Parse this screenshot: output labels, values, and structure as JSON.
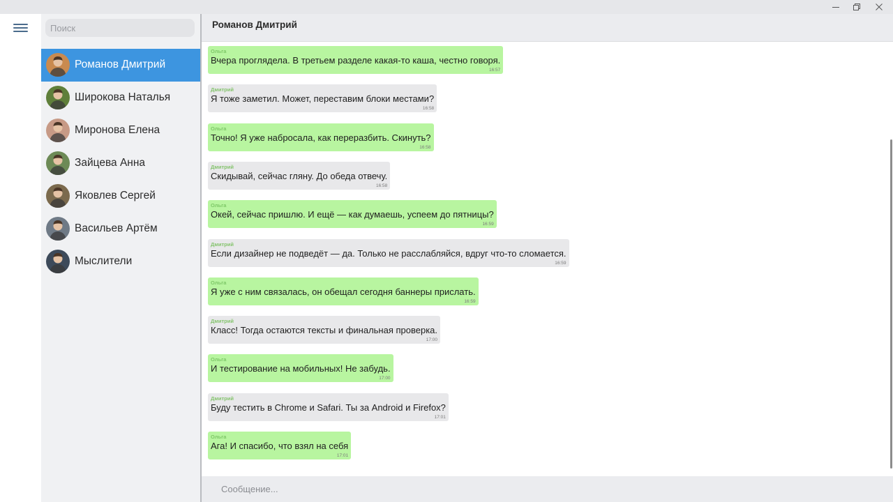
{
  "window": {
    "min_icon": "minimize-icon",
    "max_icon": "restore-icon",
    "close_icon": "close-icon"
  },
  "rail": {
    "menu_icon": "hamburger-menu-icon"
  },
  "sidebar": {
    "search_placeholder": "Поиск",
    "chats": [
      {
        "name": "Романов Дмитрий",
        "avatar_color": "#c98a4f",
        "active": true
      },
      {
        "name": "Широкова Наталья",
        "avatar_color": "#5f7f3a",
        "active": false
      },
      {
        "name": "Миронова Елена",
        "avatar_color": "#c79a86",
        "active": false
      },
      {
        "name": "Зайцева Анна",
        "avatar_color": "#6d8a56",
        "active": false
      },
      {
        "name": "Яковлев Сергей",
        "avatar_color": "#7b6a4d",
        "active": false
      },
      {
        "name": "Васильев Артём",
        "avatar_color": "#6f7a86",
        "active": false
      },
      {
        "name": "Мыслители",
        "avatar_color": "#3d4a5a",
        "active": false
      }
    ]
  },
  "header": {
    "title": "Романов Дмитрий"
  },
  "messages": [
    {
      "author": "Ольга",
      "text": "Вчера проглядела. В третьем разделе какая-то каша, честно говоря.",
      "time": "16:57",
      "mine": true
    },
    {
      "author": "Дмитрий",
      "text": "Я тоже заметил. Может, переставим блоки местами?",
      "time": "16:58",
      "mine": false
    },
    {
      "author": "Ольга",
      "text": "Точно! Я уже набросала, как переразбить. Скинуть?",
      "time": "16:58",
      "mine": true
    },
    {
      "author": "Дмитрий",
      "text": "Скидывай, сейчас гляну. До обеда отвечу.",
      "time": "16:58",
      "mine": false
    },
    {
      "author": "Ольга",
      "text": "Окей, сейчас пришлю. И ещё — как думаешь, успеем до пятницы?",
      "time": "16:59",
      "mine": true
    },
    {
      "author": "Дмитрий",
      "text": "Если дизайнер не подведёт — да. Только не расслабляйся, вдруг что-то сломается.",
      "time": "16:59",
      "mine": false
    },
    {
      "author": "Ольга",
      "text": "Я уже с ним связалась, он обещал сегодня баннеры прислать.",
      "time": "16:59",
      "mine": true
    },
    {
      "author": "Дмитрий",
      "text": "Класс! Тогда остаются тексты и финальная проверка.",
      "time": "17:00",
      "mine": false
    },
    {
      "author": "Ольга",
      "text": "И тестирование на мобильных! Не забудь.",
      "time": "17:00",
      "mine": true
    },
    {
      "author": "Дмитрий",
      "text": "Буду тестить в Chrome и Safari. Ты за Android и Firefox?",
      "time": "17:01",
      "mine": false
    },
    {
      "author": "Ольга",
      "text": "Ага! И спасибо, что взял на себя",
      "time": "17:01",
      "mine": true
    }
  ],
  "composer": {
    "placeholder": "Сообщение..."
  },
  "colors": {
    "accent": "#3d95e0",
    "my_bubble": "#b8f5a0",
    "their_bubble": "#e8e8ea",
    "author_name": "#7ec868"
  }
}
